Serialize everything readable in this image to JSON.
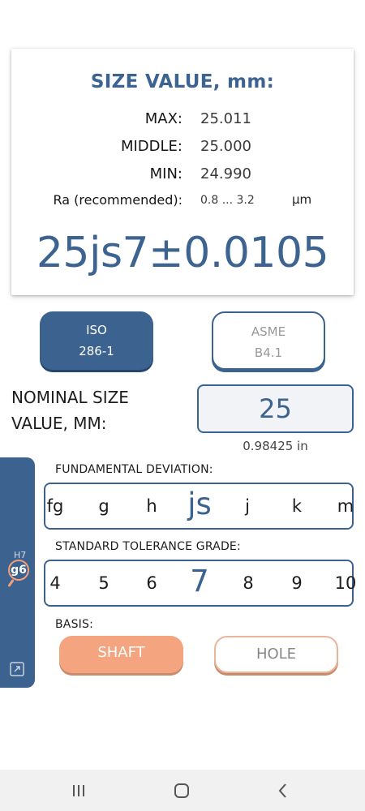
{
  "result": {
    "title": "SIZE VALUE, mm:",
    "max_label": "MAX:",
    "max_value": "25.011",
    "middle_label": "MIDDLE:",
    "middle_value": "25.000",
    "min_label": "MIN:",
    "min_value": "24.990",
    "ra_label": "Ra (recommended):",
    "ra_value": "0.8 ... 3.2",
    "ra_unit": "µm",
    "fit": "25js7±0.0105"
  },
  "standards": {
    "iso_label_1": "ISO",
    "iso_label_2": "286-1",
    "asme_label_1": "ASME",
    "asme_label_2": "B4.1",
    "selected": "ISO"
  },
  "nominal": {
    "label_line1": "NOMINAL SIZE",
    "label_line2": "VALUE, MM:",
    "value": "25",
    "inches": "0.98425 in"
  },
  "side_panel": {
    "hole_fit": "H7",
    "shaft_fit": "g6"
  },
  "deviation": {
    "label": "FUNDAMENTAL DEVIATION:",
    "items": [
      "fg",
      "g",
      "h",
      "js",
      "j",
      "k",
      "m"
    ],
    "selected": "js"
  },
  "tolerance": {
    "label": "STANDARD TOLERANCE GRADE:",
    "items": [
      "4",
      "5",
      "6",
      "7",
      "8",
      "9",
      "10"
    ],
    "selected": "7"
  },
  "basis": {
    "label": "BASIS:",
    "shaft": "SHAFT",
    "hole": "HOLE",
    "selected": "SHAFT"
  },
  "colors": {
    "accent": "#3c628f",
    "basis_accent": "#f4a47e"
  },
  "icons": [
    "recent-apps-icon",
    "home-icon",
    "back-icon",
    "magnifier-icon",
    "expand-icon"
  ]
}
